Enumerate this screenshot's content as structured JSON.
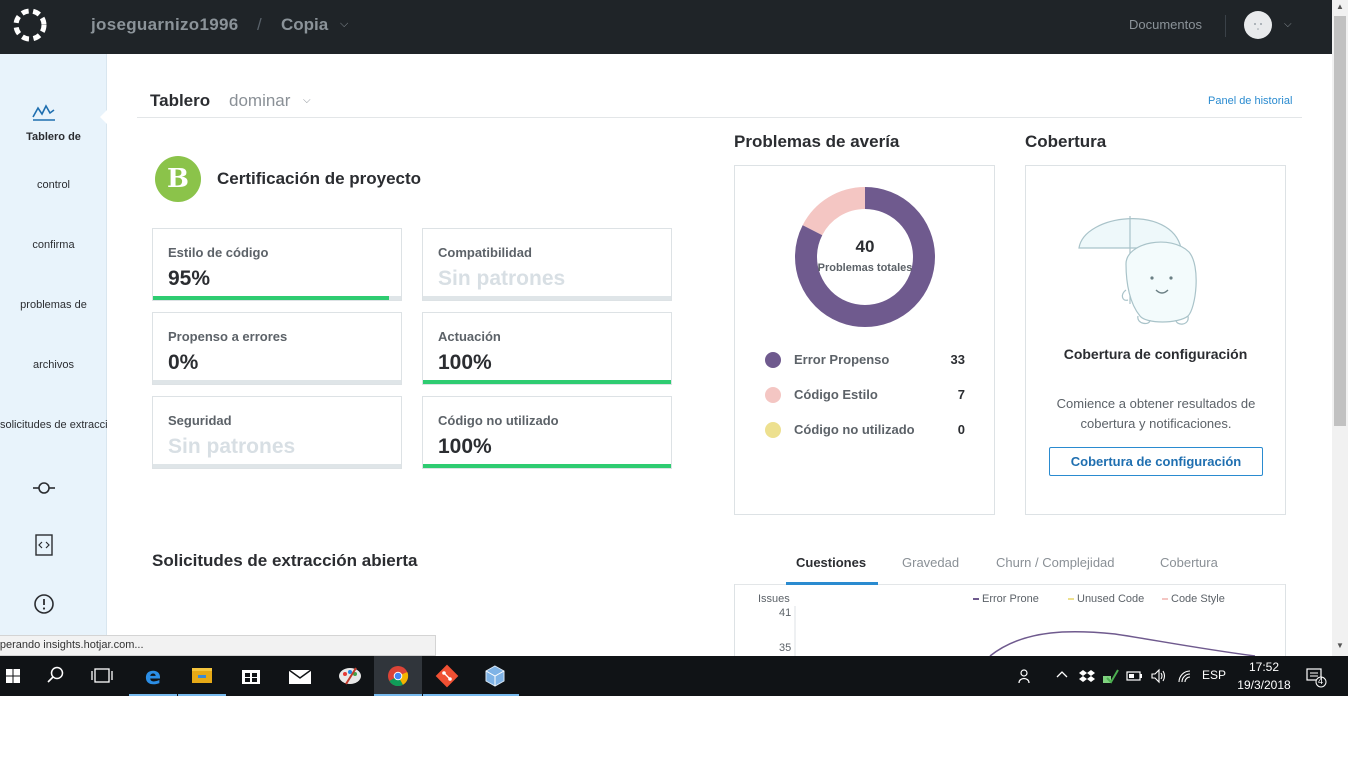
{
  "topbar": {
    "username": "joseguarnizo1996",
    "separator": "/",
    "repository": "Copia",
    "docs_link": "Documentos"
  },
  "sidebar": {
    "items": [
      {
        "label": "Tablero de",
        "icon": "dashboard-icon"
      },
      {
        "label": "control"
      },
      {
        "label": "confirma"
      },
      {
        "label": "problemas de"
      },
      {
        "label": "archivos"
      },
      {
        "label": "solicitudes de extracción"
      }
    ],
    "icons": [
      "commit-icon",
      "code-file-icon",
      "alert-circle-icon"
    ]
  },
  "header": {
    "title": "Tablero",
    "branch": "dominar",
    "history_link": "Panel de historial"
  },
  "certification": {
    "grade": "B",
    "title": "Certificación de proyecto",
    "metrics": [
      {
        "label": "Estilo de código",
        "value": "95%",
        "fill": 0.95,
        "muted": false
      },
      {
        "label": "Compatibilidad",
        "value": "Sin patrones",
        "fill": 0,
        "muted": true
      },
      {
        "label": "Propenso a errores",
        "value": "0%",
        "fill": 0,
        "muted": false
      },
      {
        "label": "Actuación",
        "value": "100%",
        "fill": 1.0,
        "muted": false
      },
      {
        "label": "Seguridad",
        "value": "Sin patrones",
        "fill": 0,
        "muted": true
      },
      {
        "label": "Código no utilizado",
        "value": "100%",
        "fill": 1.0,
        "muted": false
      }
    ]
  },
  "pull_requests": {
    "title": "Solicitudes de extracción abierta"
  },
  "breakdown": {
    "title": "Problemas de avería",
    "total": "40",
    "total_caption": "Problemas totales",
    "items": [
      {
        "name": "Error Propenso",
        "count": "33",
        "color": "#6f5a8e"
      },
      {
        "name": "Código Estilo",
        "count": "7",
        "color": "#f4c6c3"
      },
      {
        "name": "Código no utilizado",
        "count": "0",
        "color": "#ede08f"
      }
    ]
  },
  "coverage": {
    "title": "Cobertura",
    "heading": "Cobertura de configuración",
    "text": "Comience a obtener resultados de cobertura y notificaciones.",
    "button": "Cobertura de configuración"
  },
  "chart_tabs": {
    "tabs": [
      "Cuestiones",
      "Gravedad",
      "Churn / Complejidad",
      "Cobertura"
    ],
    "active": "Cuestiones"
  },
  "chart_data": {
    "type": "line",
    "ylabel": "Issues",
    "y_ticks": [
      "41",
      "35"
    ],
    "series": [
      {
        "name": "Error Prone",
        "color": "#6f5a8e"
      },
      {
        "name": "Unused Code",
        "color": "#ede08f"
      },
      {
        "name": "Code Style",
        "color": "#f4c6c3"
      }
    ]
  },
  "status_bar": {
    "text": "Esperando insights.hotjar.com..."
  },
  "taskbar": {
    "language": "ESP",
    "time": "17:52",
    "date": "19/3/2018",
    "notifications": "4",
    "apps": [
      "start-icon",
      "search-icon",
      "task-view-icon",
      "edge-icon",
      "file-explorer-icon",
      "store-icon",
      "mail-icon",
      "paint-icon",
      "chrome-icon",
      "git-icon",
      "virtualbox-icon"
    ]
  }
}
